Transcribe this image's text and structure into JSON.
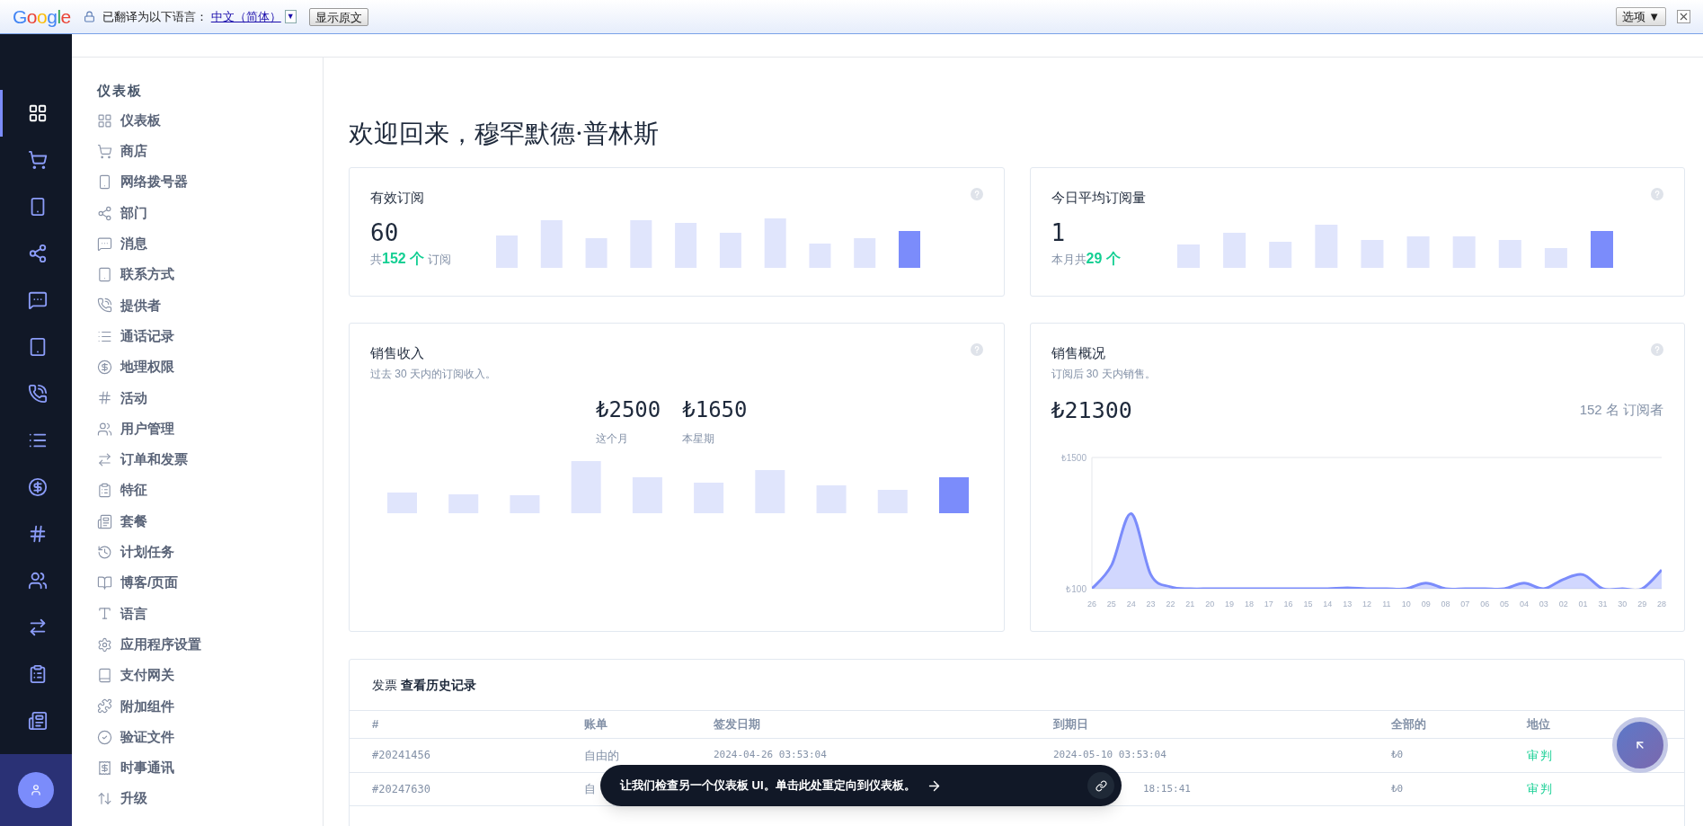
{
  "translate_bar": {
    "logo": "Google",
    "message": "已翻译为以下语言：",
    "language": "中文（简体）",
    "dropdown": "▼",
    "show_original": "显示原文",
    "options": "选项 ▼"
  },
  "rail": [
    {
      "selected": true
    },
    {
      "selected": false
    },
    {
      "selected": false
    },
    {
      "selected": false
    },
    {
      "selected": false
    },
    {
      "selected": false
    },
    {
      "selected": false
    },
    {
      "selected": false
    },
    {
      "selected": false
    },
    {
      "selected": false
    },
    {
      "selected": false
    },
    {
      "selected": false
    },
    {
      "selected": false
    },
    {
      "selected": false
    }
  ],
  "menu": {
    "heading": "仪表板",
    "items": [
      {
        "label": "仪表板"
      },
      {
        "label": "商店"
      },
      {
        "label": "网络拨号器"
      },
      {
        "label": "部门"
      },
      {
        "label": "消息"
      },
      {
        "label": "联系方式"
      },
      {
        "label": "提供者"
      },
      {
        "label": "通话记录"
      },
      {
        "label": "地理权限"
      },
      {
        "label": "活动"
      },
      {
        "label": "用户管理"
      },
      {
        "label": "订单和发票"
      },
      {
        "label": "特征"
      },
      {
        "label": "套餐"
      },
      {
        "label": "计划任务"
      },
      {
        "label": "博客/页面"
      },
      {
        "label": "语言"
      },
      {
        "label": "应用程序设置"
      },
      {
        "label": "支付网关"
      },
      {
        "label": "附加组件"
      },
      {
        "label": "验证文件"
      },
      {
        "label": "时事通讯"
      },
      {
        "label": "升级"
      }
    ]
  },
  "welcome": "欢迎回来，穆罕默德·普林斯",
  "active_subscriptions": {
    "title": "有效订阅",
    "value": "60",
    "note": "共**152 个** 订阅"
  },
  "daily_average": {
    "title": "今日平均订阅量",
    "value": "1",
    "note": "本月共**29 个**"
  },
  "sales_revenue": {
    "title": "销售收入",
    "subtitle": "过去 30 天内的订阅收入。",
    "figures": [
      {
        "amount": "₺2500",
        "label": "这个月"
      },
      {
        "amount": "₺1650",
        "label": "本星期"
      }
    ]
  },
  "sales_overview": {
    "title": "销售概况",
    "subtitle": "订阅后 30 天内销售。",
    "total": "₺21300",
    "subscribers": "152 名 订阅者",
    "chart_data": {
      "type": "area",
      "categories": [
        "26",
        "25",
        "24",
        "23",
        "22",
        "21",
        "20",
        "19",
        "18",
        "17",
        "16",
        "15",
        "14",
        "13",
        "12",
        "11",
        "10",
        "09",
        "08",
        "07",
        "06",
        "05",
        "04",
        "03",
        "02",
        "01",
        "31",
        "30",
        "29",
        "28"
      ],
      "series": [
        {
          "color": "#7b8cfb",
          "values": [
            100,
            350,
            900,
            250,
            120,
            100,
            100,
            100,
            100,
            100,
            100,
            100,
            100,
            110,
            100,
            100,
            100,
            160,
            100,
            100,
            100,
            100,
            160,
            100,
            200,
            250,
            100,
            100,
            100,
            300
          ]
        }
      ],
      "ylim": [
        100,
        1500
      ],
      "yticks": [
        {
          "value": 100,
          "label": "₺100"
        },
        {
          "value": 1500,
          "label": "₺1500"
        }
      ]
    }
  },
  "invoices": {
    "title": "发票 **查看历史记录**",
    "columns": [
      "#",
      "账单",
      "签发日期",
      "到期日",
      "全部的",
      "地位"
    ],
    "rows": [
      {
        "id": "#20241456",
        "bill": "自由的",
        "issue_date": "2024-04-26 03:53:04",
        "due_date": "2024-05-10 03:53:04",
        "amount": "₺0",
        "status": "审判"
      },
      {
        "id": "#20247630",
        "bill": "自",
        "due_date": "18:15:41",
        "amount": "₺0",
        "status": "审判"
      }
    ]
  },
  "toast": {
    "message": "让我们检查另一个仪表板 UI。单击此处重定向到仪表板。"
  }
}
